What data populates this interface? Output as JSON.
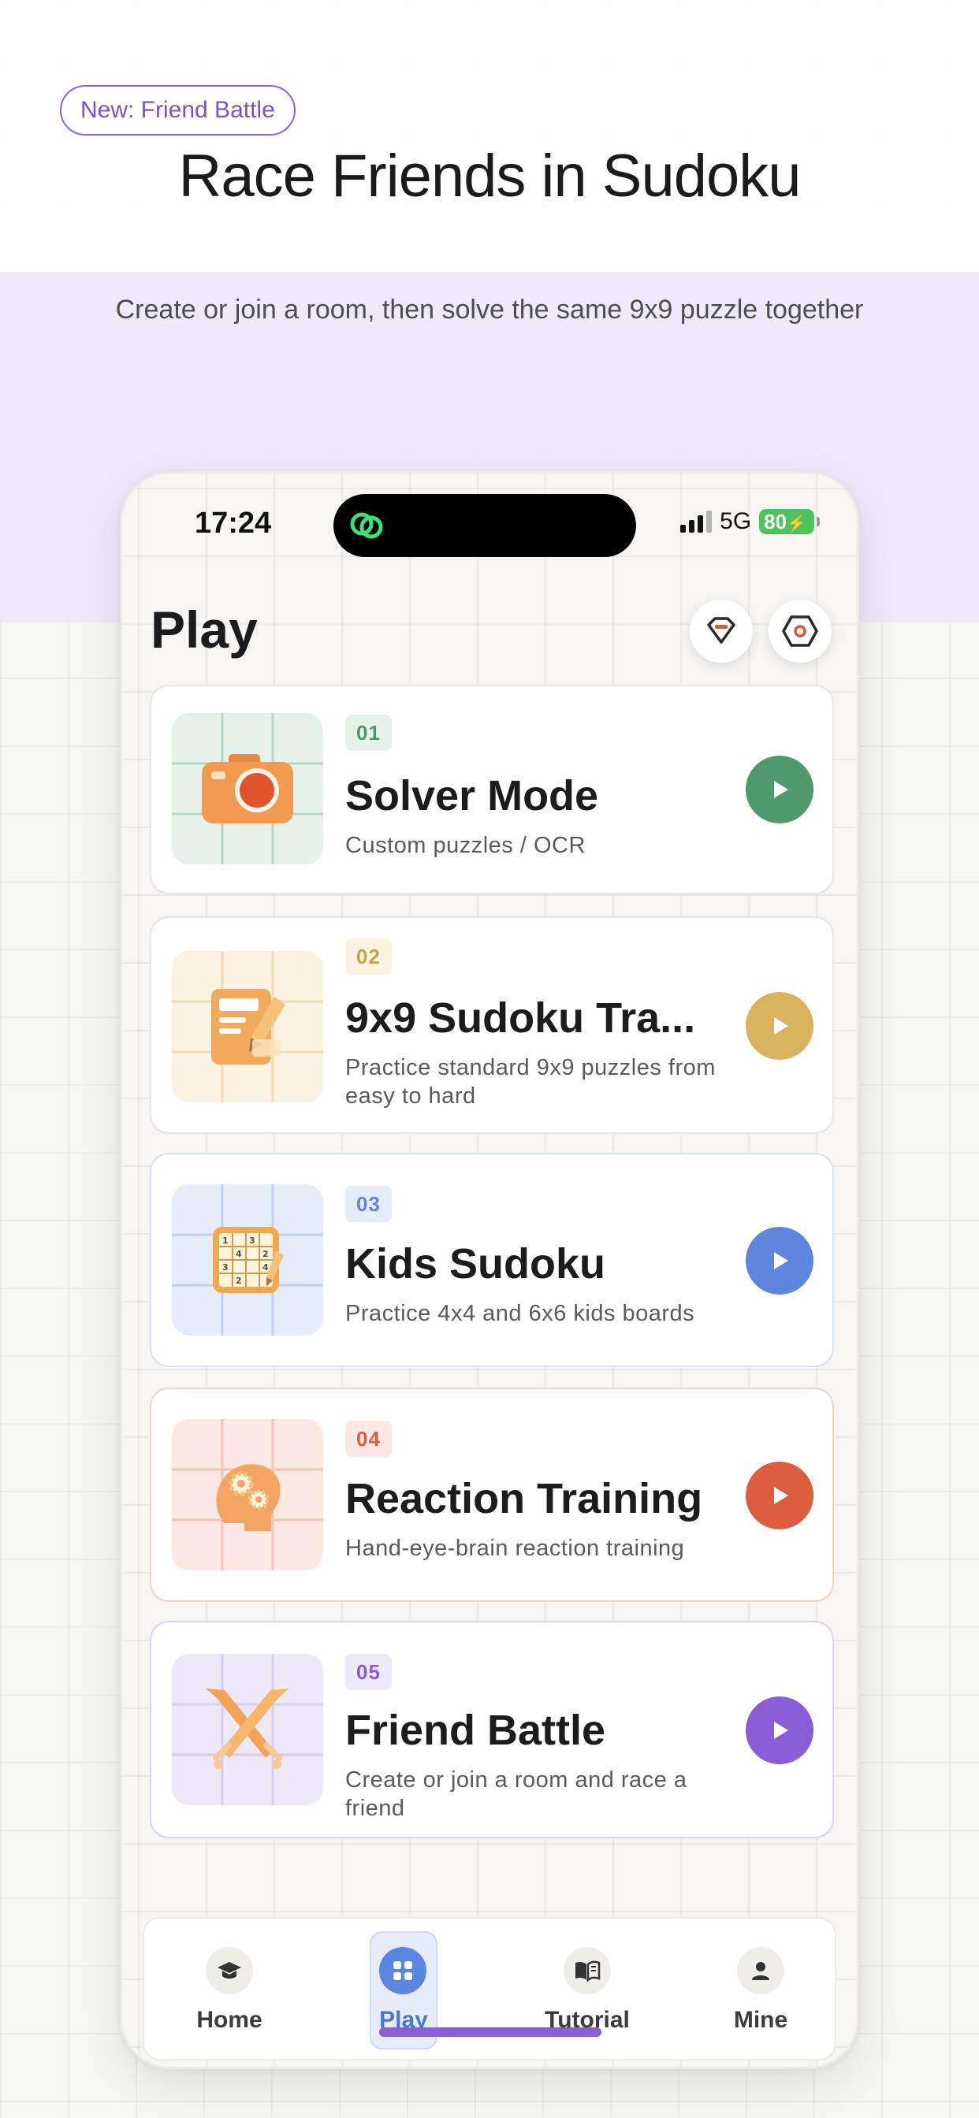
{
  "promo": {
    "badge": "New: Friend Battle",
    "headline": "Race Friends in Sudoku",
    "subline": "Create or join a room, then solve the same 9x9 puzzle together"
  },
  "status_bar": {
    "time": "17:24",
    "network": "5G",
    "battery": "80"
  },
  "screen": {
    "title": "Play",
    "header_icons": [
      "gem-icon",
      "hexagon-settings-icon"
    ]
  },
  "modes": [
    {
      "num": "01",
      "title": "Solver Mode",
      "desc": "Custom puzzles / OCR",
      "accent": "#4e9a6c",
      "tint": "#e6f1ea",
      "icon": "camera-icon"
    },
    {
      "num": "02",
      "title": "9x9 Sudoku Tra...",
      "desc": "Practice standard 9x9 puzzles from easy to hard",
      "accent": "#d8b25c",
      "tint": "#faf3e2",
      "icon": "notepad-pencil-icon"
    },
    {
      "num": "03",
      "title": "Kids Sudoku",
      "desc": "Practice 4x4 and 6x6 kids boards",
      "accent": "#5f86dd",
      "tint": "#e6ecfa",
      "icon": "sudoku-board-icon"
    },
    {
      "num": "04",
      "title": "Reaction Training",
      "desc": "Hand-eye-brain reaction training",
      "accent": "#dc5d3f",
      "tint": "#fbe8e3",
      "icon": "brain-gears-icon"
    },
    {
      "num": "05",
      "title": "Friend Battle",
      "desc": "Create or join a room and race a friend",
      "accent": "#8a5cd6",
      "tint": "#eee9f9",
      "icon": "crossed-swords-icon"
    }
  ],
  "tabs": [
    {
      "label": "Home",
      "icon": "graduation-cap-icon"
    },
    {
      "label": "Play",
      "icon": "grid-icon",
      "active": true
    },
    {
      "label": "Tutorial",
      "icon": "book-icon"
    },
    {
      "label": "Mine",
      "icon": "person-icon"
    }
  ],
  "colors": {
    "brand_purple": "#8a5cd6",
    "active_blue": "#5b86e0",
    "lavender_band": "#ece8fa"
  }
}
